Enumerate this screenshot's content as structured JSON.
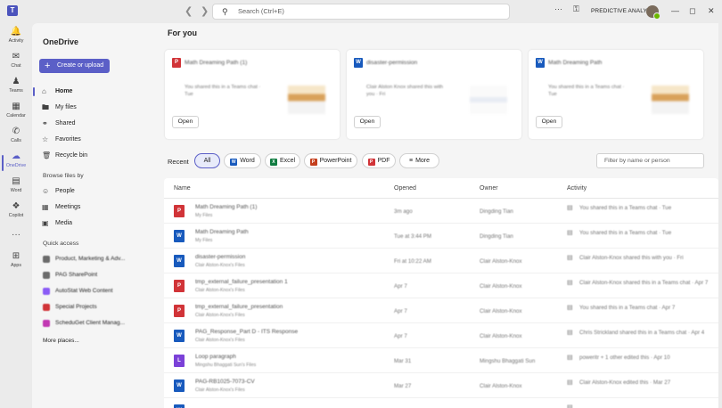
{
  "titlebar": {
    "search_placeholder": "Search (Ctrl+E)",
    "org_name": "PREDICTIVE ANALYTI...",
    "more_icon": "ellipsis-icon"
  },
  "rail": [
    {
      "label": "Activity",
      "icon": "bell-icon"
    },
    {
      "label": "Chat",
      "icon": "chat-icon"
    },
    {
      "label": "Teams",
      "icon": "teams-icon"
    },
    {
      "label": "Calendar",
      "icon": "calendar-icon"
    },
    {
      "label": "Calls",
      "icon": "phone-icon"
    },
    {
      "label": "OneDrive",
      "icon": "cloud-icon"
    },
    {
      "label": "Word",
      "icon": "word-icon"
    },
    {
      "label": "Copilot",
      "icon": "copilot-icon"
    },
    {
      "label": "Apps",
      "icon": "apps-icon"
    }
  ],
  "nav": {
    "title": "OneDrive",
    "create_label": "Create or upload",
    "items": [
      "Home",
      "My files",
      "Shared",
      "Favorites",
      "Recycle bin"
    ],
    "browse_header": "Browse files by",
    "browse_items": [
      "People",
      "Meetings",
      "Media"
    ],
    "quick_access_header": "Quick access",
    "quick_access": [
      {
        "label": "Product, Marketing & Adv...",
        "color": "#6b6b6b"
      },
      {
        "label": "PAG SharePoint",
        "color": "#6b6b6b"
      },
      {
        "label": "AutoStat Web Content",
        "color": "#8b5cf6"
      },
      {
        "label": "Special Projects",
        "color": "#d13438"
      },
      {
        "label": "ScheduGet Client Manag...",
        "color": "#c239b3"
      }
    ],
    "more_places": "More places..."
  },
  "main": {
    "for_you": "For you",
    "cards": [
      {
        "title": "Math Dreaming Path (1)",
        "type": "pdf",
        "body": "You shared this in a Teams chat · Tue",
        "open": "Open"
      },
      {
        "title": "disaster-permission",
        "type": "word",
        "body": "Clair Alston Knox shared this with you · Fri",
        "open": "Open"
      },
      {
        "title": "Math Dreaming Path",
        "type": "word",
        "body": "You shared this in a Teams chat · Tue",
        "open": "Open"
      }
    ],
    "recent_label": "Recent",
    "filters": [
      "All",
      "Word",
      "Excel",
      "PowerPoint",
      "PDF",
      "More"
    ],
    "filter_placeholder": "Filter by name or person",
    "columns": [
      "Name",
      "Opened",
      "Owner",
      "Activity"
    ],
    "rows": [
      {
        "type": "pdf",
        "name": "Math Dreaming Path (1)",
        "loc": "My Files",
        "opened": "3m ago",
        "owner": "Dingding Tian",
        "activity": "You shared this in a Teams chat · Tue"
      },
      {
        "type": "word",
        "name": "Math Dreaming Path",
        "loc": "My Files",
        "opened": "Tue at 3:44 PM",
        "owner": "Dingding Tian",
        "activity": "You shared this in a Teams chat · Tue"
      },
      {
        "type": "word",
        "name": "disaster-permission",
        "loc": "Clair Alston-Knox's Files",
        "opened": "Fri at 10:22 AM",
        "owner": "Clair Alston-Knox",
        "activity": "Clair Alston-Knox shared this with you · Fri"
      },
      {
        "type": "pdf",
        "name": "tmp_external_failure_presentation 1",
        "loc": "Clair Alston-Knox's Files",
        "opened": "Apr 7",
        "owner": "Clair Alston-Knox",
        "activity": "Clair Alston-Knox shared this in a Teams chat · Apr 7"
      },
      {
        "type": "pdf",
        "name": "tmp_external_failure_presentation",
        "loc": "Clair Alston-Knox's Files",
        "opened": "Apr 7",
        "owner": "Clair Alston-Knox",
        "activity": "You shared this in a Teams chat · Apr 7"
      },
      {
        "type": "word",
        "name": "PAG_Response_Part D - ITS Response",
        "loc": "Clair Alston-Knox's Files",
        "opened": "Apr 7",
        "owner": "Clair Alston-Knox",
        "activity": "Chris Strickland shared this in a Teams chat · Apr 4"
      },
      {
        "type": "loop",
        "name": "Loop paragraph",
        "loc": "Mingshu Bhaggati Sun's Files",
        "opened": "Mar 31",
        "owner": "Mingshu Bhaggati Sun",
        "activity": "poweritr + 1 other edited this · Apr 10"
      },
      {
        "type": "word",
        "name": "PAG-RB1025-7073-CV",
        "loc": "Clair Alston-Knox's Files",
        "opened": "Mar 27",
        "owner": "Clair Alston-Knox",
        "activity": "Clair Alston-Knox edited this · Mar 27"
      },
      {
        "type": "word",
        "name": "",
        "loc": "",
        "opened": "",
        "owner": "",
        "activity": ""
      }
    ]
  },
  "colors": {
    "accent": "#5b5fc7",
    "word": "#185abd",
    "excel": "#107c41",
    "ppt": "#c43e1c",
    "pdf": "#d13438",
    "loop": "#7b41d8"
  }
}
